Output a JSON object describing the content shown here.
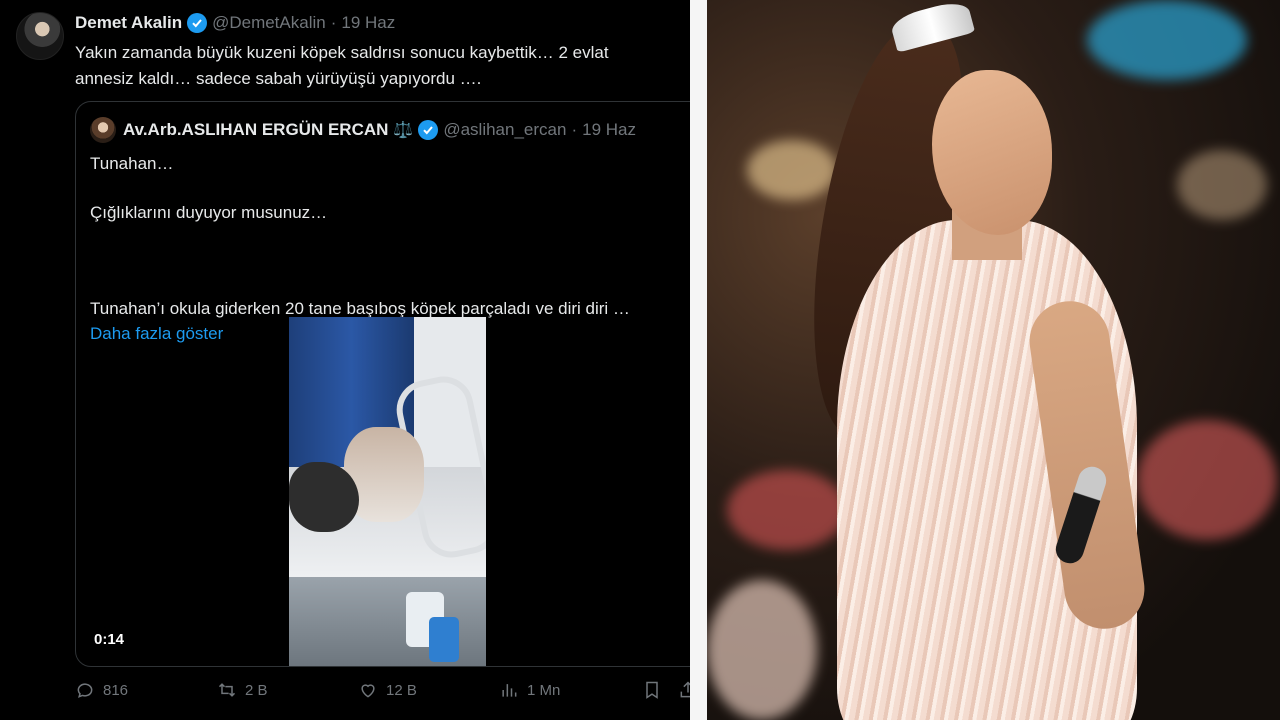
{
  "tweet": {
    "author_name": "Demet Akalin",
    "author_handle": "@DemetAkalin",
    "separator": "·",
    "date": "19 Haz",
    "text_line1": "Yakın zamanda büyük kuzeni köpek saldrısı sonucu kaybettik… 2 evlat",
    "text_line2": "annesiz kaldı… sadece sabah yürüyüşü yapıyordu ….",
    "verified": true
  },
  "quote": {
    "author_name": "Av.Arb.ASLIHAN ERGÜN ERCAN",
    "author_emoji": "⚖️",
    "author_handle": "@aslihan_ercan",
    "separator": "·",
    "date": "19 Haz",
    "line1": "Tunahan…",
    "line2": "Çığlıklarını duyuyor musunuz…",
    "line3": "Tunahan’ı okula giderken 20 tane başıboş köpek parçaladı ve diri diri …",
    "show_more": "Daha fazla göster",
    "video_time": "0:14"
  },
  "actions": {
    "replies": "816",
    "retweets": "2 B",
    "likes": "12 B",
    "views": "1 Mn"
  },
  "colors": {
    "accent": "#1d9bf0",
    "muted": "#71767b",
    "text": "#e7e9ea",
    "background": "#000000"
  },
  "icons": [
    "verified-badge-icon",
    "scales-emoji",
    "reply-icon",
    "retweet-icon",
    "like-icon",
    "views-icon",
    "bookmark-icon",
    "share-icon"
  ]
}
